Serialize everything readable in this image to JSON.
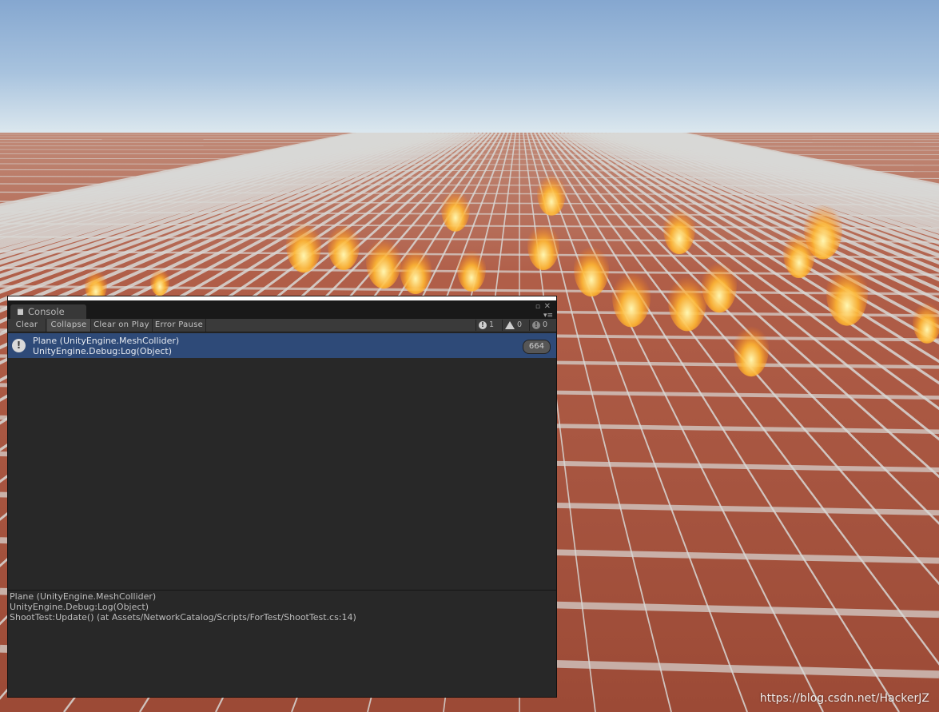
{
  "console": {
    "tab_title": "Console",
    "toolbar": {
      "clear": "Clear",
      "collapse": "Collapse",
      "clear_on_play": "Clear on Play",
      "error_pause": "Error Pause"
    },
    "counters": {
      "logs": "1",
      "warnings": "0",
      "errors": "0"
    },
    "entries": [
      {
        "line1": "Plane (UnityEngine.MeshCollider)",
        "line2": "UnityEngine.Debug:Log(Object)",
        "count": "664",
        "selected": true,
        "icon": "info-icon"
      }
    ],
    "details": [
      "Plane (UnityEngine.MeshCollider)",
      "UnityEngine.Debug:Log(Object)",
      "ShootTest:Update() (at Assets/NetworkCatalog/Scripts/ForTest/ShootTest.cs:14)"
    ]
  },
  "watermark": "https://blog.csdn.net/HackerJZ",
  "colors": {
    "selection": "#2e4a78",
    "panel": "#282828",
    "toolbar": "#3a3a3a"
  }
}
